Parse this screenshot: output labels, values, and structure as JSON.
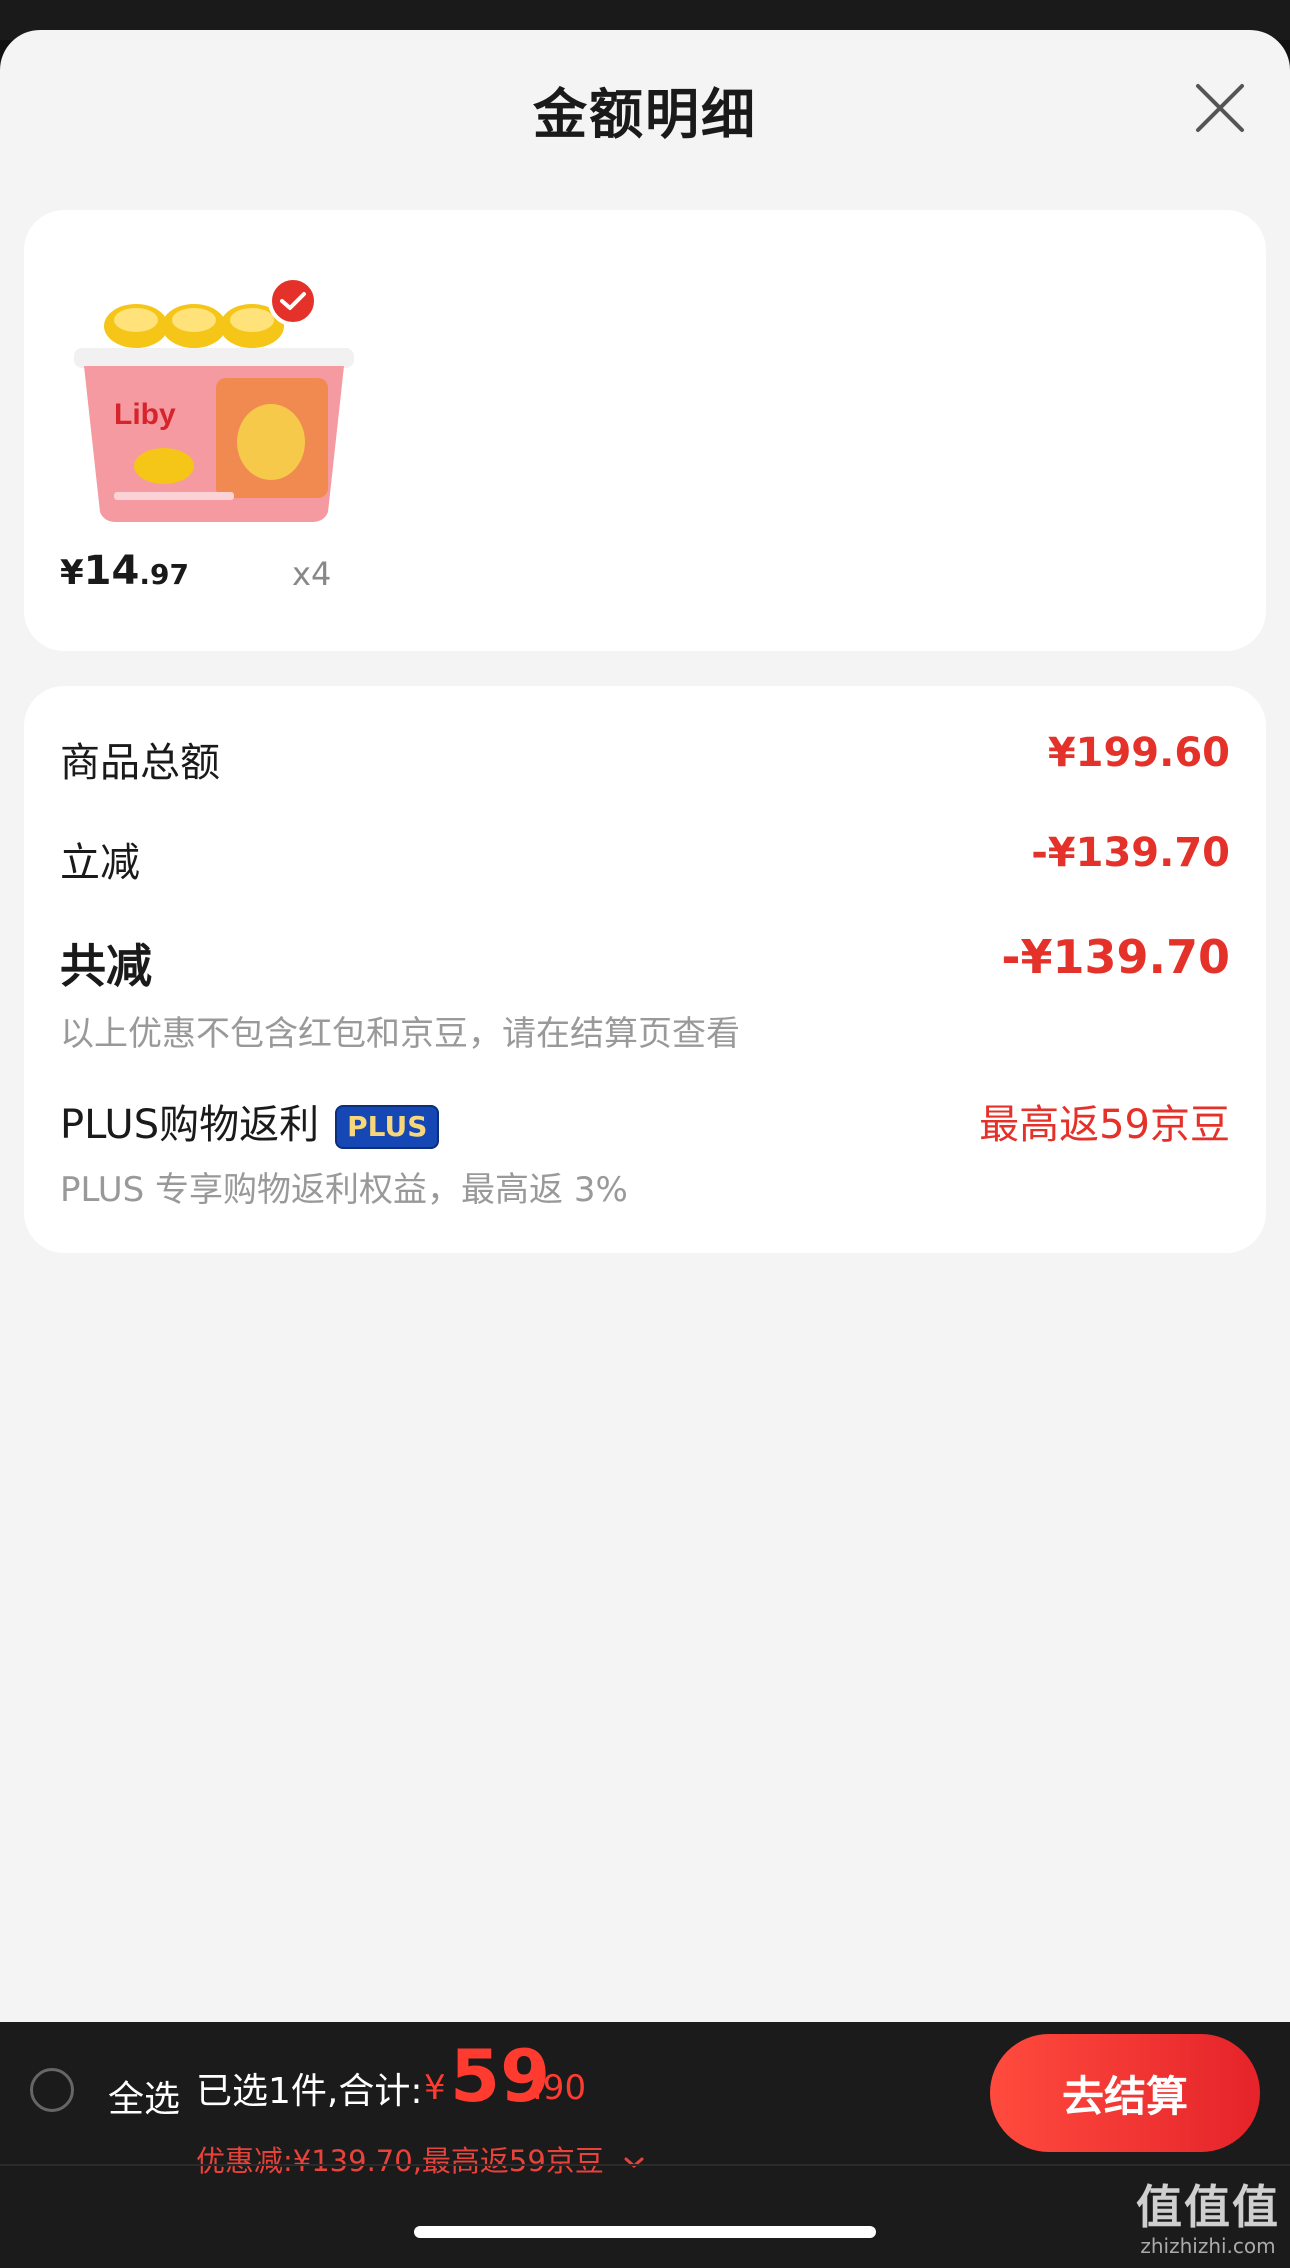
{
  "sheet": {
    "title": "金额明细"
  },
  "product": {
    "price_yen": "¥",
    "price_int": "14",
    "price_dec": ".97",
    "quantity": "x4",
    "brand_text": "Liby"
  },
  "summary": {
    "goods_total_label": "商品总额",
    "goods_total_value": "¥199.60",
    "instant_discount_label": "立减",
    "instant_discount_value": "-¥139.70",
    "total_discount_label": "共减",
    "total_discount_value": "-¥139.70",
    "note": "以上优惠不包含红包和京豆，请在结算页查看",
    "plus_label": "PLUS购物返利",
    "plus_badge": "PLUS",
    "plus_value": "最高返59京豆",
    "plus_sub": "PLUS 专享购物返利权益，最高返 3%"
  },
  "bottom_bar": {
    "select_all": "全选",
    "selected": "已选1件,合计:",
    "total_yen": "¥",
    "total_int": "59",
    "total_dec": ".90",
    "discount_info": "优惠减:¥139.70,最高返59京豆",
    "checkout": "去结算"
  },
  "watermark": {
    "main": "值值值",
    "sub": "zhizhizhi.com"
  },
  "colors": {
    "accent": "#e4322a",
    "plus_badge_bg": "#1548b4",
    "checkout_button": "#ff4b3e"
  }
}
